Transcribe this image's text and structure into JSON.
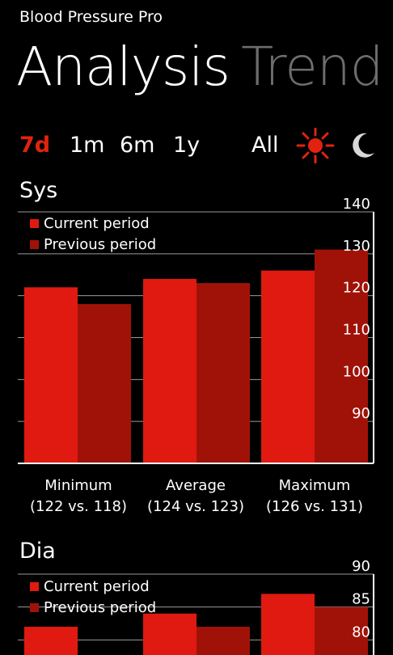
{
  "app": {
    "title": "Blood Pressure Pro"
  },
  "pivot": {
    "active": "Analysis",
    "inactive": "Trend"
  },
  "filters": [
    "7d",
    "1m",
    "6m",
    "1y",
    "All"
  ],
  "active_filter": "7d",
  "icons": {
    "day": "sun-icon",
    "night": "moon-icon"
  },
  "colors": {
    "current": "#e01a10",
    "previous": "#a01208",
    "accent": "#e0230f",
    "inactive": "#6d6d6d"
  },
  "sys": {
    "title": "Sys",
    "captions": [
      {
        "name": "Minimum",
        "detail": "(122 vs. 118)"
      },
      {
        "name": "Average",
        "detail": "(124 vs. 123)"
      },
      {
        "name": "Maximum",
        "detail": "(126 vs. 131)"
      }
    ]
  },
  "dia": {
    "title": "Dia"
  },
  "chart_data": [
    {
      "type": "bar",
      "title": "Sys",
      "categories": [
        "Minimum",
        "Average",
        "Maximum"
      ],
      "series": [
        {
          "name": "Current period",
          "values": [
            122,
            124,
            126
          ]
        },
        {
          "name": "Previous period",
          "values": [
            118,
            123,
            131
          ]
        }
      ],
      "y_ticks": [
        90,
        100,
        110,
        120,
        130,
        140
      ],
      "ylim": [
        80,
        140
      ],
      "grid": true,
      "legend": "top-left"
    },
    {
      "type": "bar",
      "title": "Dia",
      "categories": [
        "Minimum",
        "Average",
        "Maximum"
      ],
      "series": [
        {
          "name": "Current period",
          "values": [
            82,
            84,
            87
          ]
        },
        {
          "name": "Previous period",
          "values": [
            null,
            82,
            85
          ]
        }
      ],
      "y_ticks": [
        80,
        85,
        90
      ],
      "ylim": [
        75,
        90
      ],
      "grid": true,
      "legend": "top-left"
    }
  ]
}
